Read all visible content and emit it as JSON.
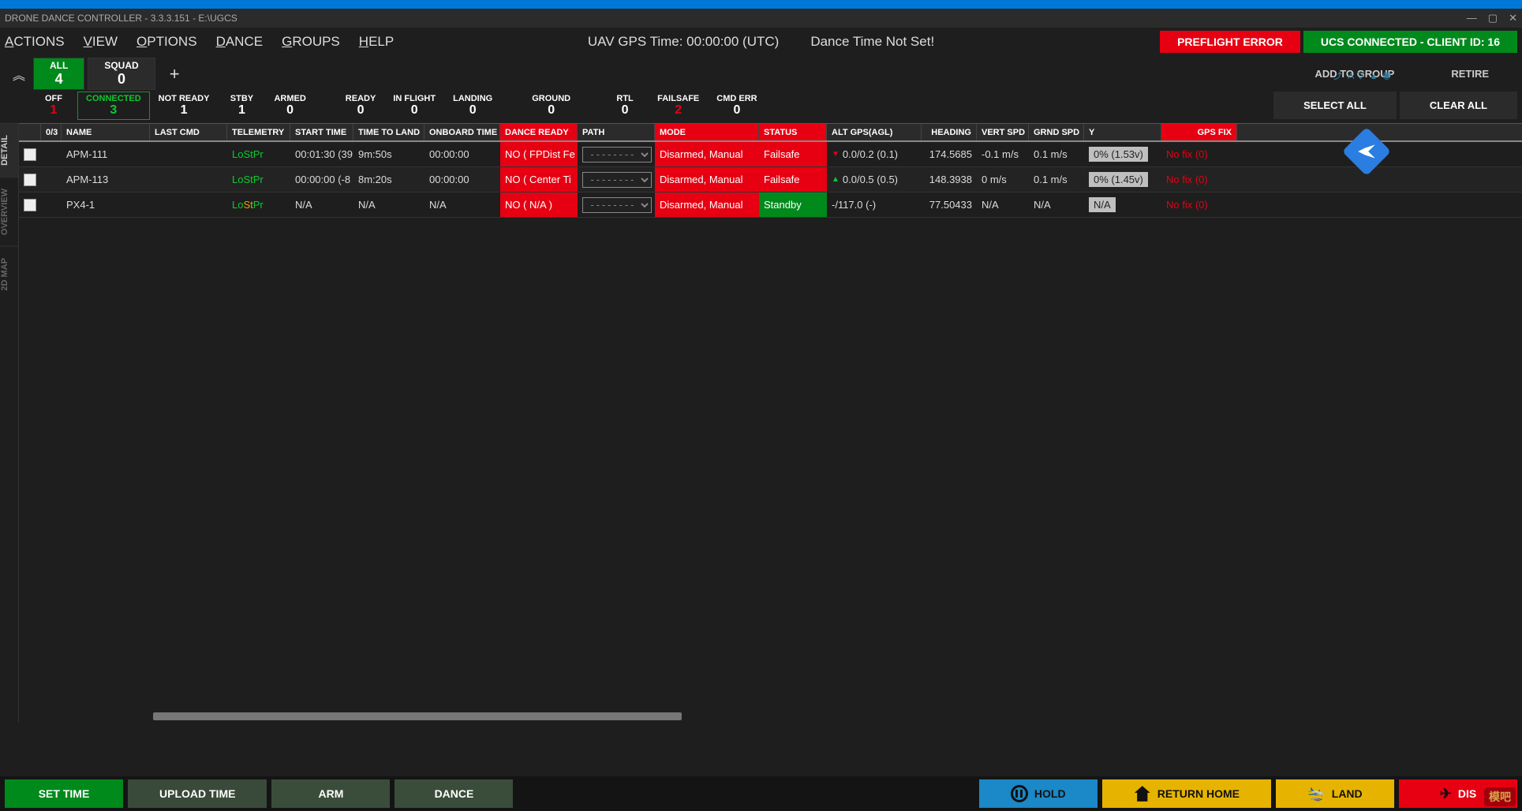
{
  "title": "DRONE DANCE CONTROLLER - 3.3.3.151 - E:\\UGCS",
  "menu": [
    "ACTIONS",
    "VIEW",
    "OPTIONS",
    "DANCE",
    "GROUPS",
    "HELP"
  ],
  "gps_time": "UAV GPS Time: 00:00:00 (UTC)",
  "dance_time": "Dance Time Not Set!",
  "preflight": "PREFLIGHT ERROR",
  "ucs": "UCS CONNECTED - CLIENT ID: 16",
  "groups": {
    "all_label": "ALL",
    "all_count": "4",
    "squad_label": "SQUAD",
    "squad_count": "0",
    "plus": "+"
  },
  "topright": {
    "add": "ADD TO GROUP",
    "retire": "RETIRE",
    "select_all": "SELECT ALL",
    "clear_all": "CLEAR ALL"
  },
  "stats": [
    {
      "label": "OFF",
      "value": "1",
      "cls": "off"
    },
    {
      "label": "CONNECTED",
      "value": "3",
      "cls": "connected"
    },
    {
      "label": "NOT READY",
      "value": "1",
      "cls": ""
    },
    {
      "label": "STBY",
      "value": "1",
      "cls": ""
    },
    {
      "label": "ARMED",
      "value": "0",
      "cls": ""
    },
    {
      "label": "READY",
      "value": "0",
      "cls": ""
    },
    {
      "label": "IN FLIGHT",
      "value": "0",
      "cls": ""
    },
    {
      "label": "LANDING",
      "value": "0",
      "cls": ""
    },
    {
      "label": "GROUND",
      "value": "0",
      "cls": ""
    },
    {
      "label": "RTL",
      "value": "0",
      "cls": ""
    },
    {
      "label": "FAILSAFE",
      "value": "2",
      "cls": "failsafe"
    },
    {
      "label": "CMD ERR",
      "value": "0",
      "cls": ""
    }
  ],
  "tabs": [
    "DETAIL",
    "OVERVIEW",
    "2D MAP"
  ],
  "headers": {
    "sel": "0/3",
    "name": "NAME",
    "last": "LAST CMD",
    "tel": "TELEMETRY",
    "start": "START TIME",
    "ttl": "TIME TO LAND",
    "onb": "ONBOARD TIME",
    "dr": "DANCE READY",
    "path": "PATH",
    "mode": "MODE",
    "stat": "STATUS",
    "alt": "ALT GPS(AGL)",
    "head": "HEADING",
    "vspd": "VERT SPD",
    "gspd": "GRND SPD",
    "bat": "Y",
    "gps": "GPS FIX"
  },
  "rows": [
    {
      "name": "APM-111",
      "tel": [
        "Lo",
        "St",
        "Pr"
      ],
      "telcls": [
        "tel-lo",
        "tel-lo",
        "tel-lo"
      ],
      "start": "00:01:30 (39",
      "ttl": "9m:50s",
      "onb": "00:00:00",
      "dr": "NO ( FPDist Fe",
      "path": "---------------",
      "mode": "Disarmed, Manual",
      "stat": "Failsafe",
      "statcls": "cell-red",
      "alt": "0.0/0.2 (0.1)",
      "caret": "down",
      "head": "174.5685",
      "vspd": "-0.1 m/s",
      "gspd": "0.1 m/s",
      "bat": "0% (1.53v)",
      "gps": "No fix (0)"
    },
    {
      "name": "APM-113",
      "tel": [
        "Lo",
        "St",
        "Pr"
      ],
      "telcls": [
        "tel-lo",
        "tel-lo",
        "tel-lo"
      ],
      "start": "00:00:00 (-8",
      "ttl": "8m:20s",
      "onb": "00:00:00",
      "dr": "NO ( Center Ti",
      "path": "---------------",
      "mode": "Disarmed, Manual",
      "stat": "Failsafe",
      "statcls": "cell-red",
      "alt": "0.0/0.5 (0.5)",
      "caret": "up",
      "head": "148.3938",
      "vspd": "0 m/s",
      "gspd": "0.1 m/s",
      "bat": "0% (1.45v)",
      "gps": "No fix (0)"
    },
    {
      "name": "PX4-1",
      "tel": [
        "Lo",
        "St",
        "Pr"
      ],
      "telcls": [
        "tel-lo",
        "tel-pr2",
        "tel-lo"
      ],
      "start": "N/A",
      "ttl": "N/A",
      "onb": "N/A",
      "dr": "NO ( N/A )",
      "path": "---------------",
      "mode": "Disarmed, Manual",
      "stat": "Standby",
      "statcls": "cell-green",
      "alt": "-/117.0 (-)",
      "caret": "",
      "head": "77.50433",
      "vspd": "N/A",
      "gspd": "N/A",
      "bat": "N/A",
      "batcls": "cell-grey",
      "gps": "No fix (0)"
    }
  ],
  "bottom": {
    "settime": "SET TIME",
    "upload": "UPLOAD TIME",
    "arm": "ARM",
    "dance": "DANCE",
    "hold": "HOLD",
    "rth": "RETURN HOME",
    "land": "LAND",
    "disarm": "DIS"
  },
  "corner": "模吧"
}
